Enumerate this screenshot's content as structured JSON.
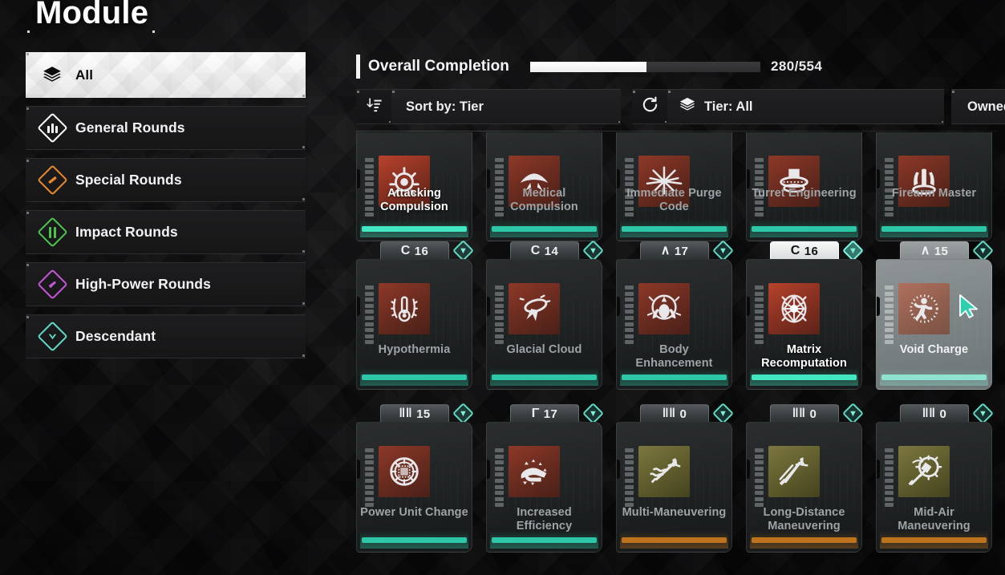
{
  "page": {
    "title": "Module"
  },
  "sidebar": {
    "items": [
      {
        "label": "All",
        "icon": "layers-stack-icon",
        "selected": true
      },
      {
        "label": "General Rounds",
        "icon": "general-rounds-diamond-icon",
        "color": "#ffffff",
        "selected": false
      },
      {
        "label": "Special Rounds",
        "icon": "special-rounds-diamond-icon",
        "color": "#e8882c",
        "selected": false
      },
      {
        "label": "Impact Rounds",
        "icon": "impact-rounds-diamond-icon",
        "color": "#4cc44c",
        "selected": false
      },
      {
        "label": "High-Power Rounds",
        "icon": "high-power-rounds-diamond-icon",
        "color": "#c456d8",
        "selected": false
      },
      {
        "label": "Descendant",
        "icon": "descendant-diamond-icon",
        "color": "#5fd9c4",
        "selected": false
      }
    ]
  },
  "completion": {
    "label": "Overall Completion",
    "current": 280,
    "total": 554,
    "value_text": "280/554",
    "percent": 50.5,
    "fill_color": "#ffffff",
    "track_color": "#37373a"
  },
  "toolbar": {
    "sort_icon": "sort-descending-icon",
    "sort_label": "Sort by: Tier",
    "reset_icon": "refresh-icon",
    "tier_icon": "layers-stack-icon",
    "tier_label": "Tier: All",
    "owned_label": "Owned: All"
  },
  "grid": {
    "cards": [
      {
        "name": "Attacking Compulsion",
        "socket": "",
        "level": "",
        "tile": "red",
        "rarity": "teal",
        "owned": true,
        "clipped": true,
        "hover": false,
        "icon": "gauge-burst-icon"
      },
      {
        "name": "Medical Compulsion",
        "socket": "",
        "level": "",
        "tile": "red",
        "rarity": "teal",
        "owned": false,
        "clipped": true,
        "hover": false,
        "icon": "medical-wings-icon"
      },
      {
        "name": "Immediate Purge Code",
        "socket": "",
        "level": "",
        "tile": "red",
        "rarity": "teal",
        "owned": false,
        "clipped": true,
        "hover": false,
        "icon": "starburst-icon"
      },
      {
        "name": "Turret Engineering",
        "socket": "",
        "level": "",
        "tile": "red",
        "rarity": "teal",
        "owned": false,
        "clipped": true,
        "hover": false,
        "icon": "turret-icon"
      },
      {
        "name": "Firearm Master",
        "socket": "",
        "level": "",
        "tile": "red",
        "rarity": "teal",
        "owned": false,
        "clipped": true,
        "hover": false,
        "icon": "firearm-icon"
      },
      {
        "name": "Hypothermia",
        "socket": "C",
        "level": "16",
        "tile": "red",
        "rarity": "teal",
        "owned": false,
        "clipped": false,
        "hover": false,
        "icon": "thermometer-frost-icon"
      },
      {
        "name": "Glacial Cloud",
        "socket": "C",
        "level": "14",
        "tile": "red",
        "rarity": "teal",
        "owned": false,
        "clipped": false,
        "hover": false,
        "icon": "glacial-cloud-icon"
      },
      {
        "name": "Body Enhancement",
        "socket": "∧",
        "level": "17",
        "tile": "red",
        "rarity": "teal",
        "owned": false,
        "clipped": false,
        "hover": false,
        "icon": "body-enhancement-icon"
      },
      {
        "name": "Matrix Recomputation",
        "socket": "C",
        "level": "16",
        "tile": "red",
        "rarity": "teal",
        "owned": true,
        "clipped": false,
        "hover": false,
        "icon": "matrix-star-icon"
      },
      {
        "name": "Void Charge",
        "socket": "∧",
        "level": "15",
        "tile": "red",
        "rarity": "teal",
        "owned": false,
        "clipped": false,
        "hover": true,
        "icon": "void-charge-icon"
      },
      {
        "name": "Power Unit Change",
        "socket": "‖‖",
        "level": "15",
        "tile": "red",
        "rarity": "teal",
        "owned": false,
        "clipped": false,
        "hover": false,
        "icon": "power-unit-icon"
      },
      {
        "name": "Increased Efficiency",
        "socket": "Γ",
        "level": "17",
        "tile": "red",
        "rarity": "teal",
        "owned": false,
        "clipped": false,
        "hover": false,
        "icon": "efficiency-hand-icon"
      },
      {
        "name": "Multi-Maneuvering",
        "socket": "‖‖",
        "level": "0",
        "tile": "gold",
        "rarity": "gold",
        "owned": false,
        "clipped": false,
        "hover": false,
        "icon": "multi-maneuver-icon"
      },
      {
        "name": "Long-Distance Maneuvering",
        "socket": "‖‖",
        "level": "0",
        "tile": "gold",
        "rarity": "gold",
        "owned": false,
        "clipped": false,
        "hover": false,
        "icon": "long-distance-maneuver-icon"
      },
      {
        "name": "Mid-Air Maneuvering",
        "socket": "‖‖",
        "level": "0",
        "tile": "gold",
        "rarity": "gold",
        "owned": false,
        "clipped": false,
        "hover": false,
        "icon": "mid-air-maneuver-icon"
      }
    ]
  },
  "cursor": {
    "icon": "pointer-arrow-cursor",
    "color": "#2ecfae"
  }
}
